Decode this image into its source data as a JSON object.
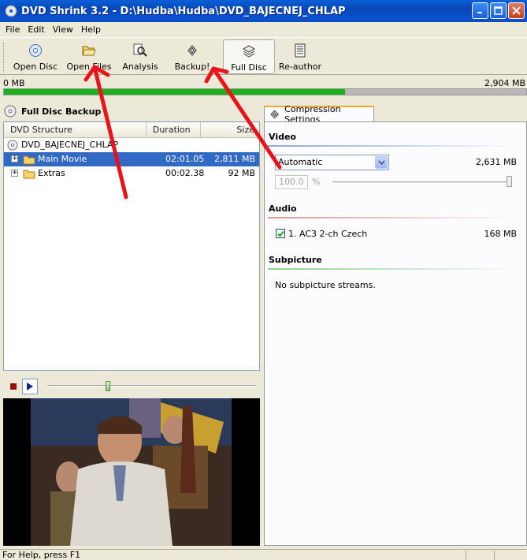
{
  "window": {
    "title": "DVD Shrink 3.2 - D:\\Hudba\\Hudba\\DVD_BAJECNEJ_CHLAP",
    "minimize_icon": "minimize-icon",
    "maximize_icon": "maximize-icon",
    "close_icon": "close-icon"
  },
  "menu": {
    "file": "File",
    "edit": "Edit",
    "view": "View",
    "help": "Help"
  },
  "toolbar": {
    "open_disc": "Open Disc",
    "open_files": "Open Files",
    "analysis": "Analysis",
    "backup": "Backup!",
    "full_disc": "Full Disc",
    "re_author": "Re-author"
  },
  "size": {
    "min_label": "0 MB",
    "max_label": "2,904 MB",
    "fill_fraction": 0.653,
    "fill_color": "#1cb01c"
  },
  "left": {
    "header": "Full Disc Backup",
    "columns": {
      "structure": "DVD Structure",
      "duration": "Duration",
      "size": "Size"
    },
    "root": "DVD_BAJECNEJ_CHLAP",
    "rows": [
      {
        "name": "Main Movie",
        "duration": "02:01.05",
        "size": "2,811 MB",
        "selected": true
      },
      {
        "name": "Extras",
        "duration": "00:02.38",
        "size": "92 MB",
        "selected": false
      }
    ],
    "selection_color": "#316ac5"
  },
  "player": {
    "position_fraction": 0.28
  },
  "right": {
    "tab": "Compression Settings",
    "video": {
      "title": "Video",
      "mode": "Automatic",
      "size": "2,631 MB",
      "percent": "100.0",
      "percent_sign": "%"
    },
    "audio": {
      "title": "Audio",
      "track": "1. AC3 2-ch Czech",
      "size": "168 MB",
      "checked": true
    },
    "subpicture": {
      "title": "Subpicture",
      "message": "No subpicture streams."
    },
    "section_colors": {
      "video": "#8ba6e2",
      "audio": "#e99090",
      "subpicture": "#8fd18f"
    }
  },
  "status": {
    "text": "For Help, press F1"
  },
  "annotation_color": "#e8131b"
}
